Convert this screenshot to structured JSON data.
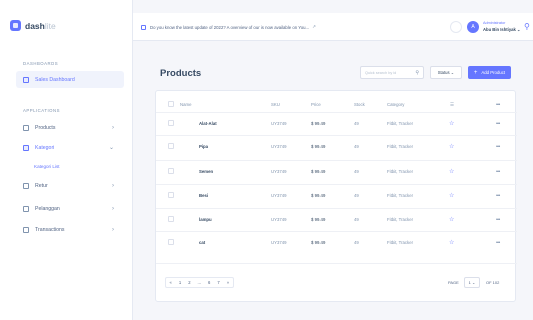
{
  "brand": {
    "name": "dash",
    "suffix": "lite"
  },
  "sidebar": {
    "sections": [
      {
        "label": "DASHBOARDS"
      },
      {
        "label": "APPLICATIONS"
      }
    ],
    "items": [
      {
        "label": "Sales Dashboard"
      },
      {
        "label": "Products",
        "chevron": "›"
      },
      {
        "label": "Kategori",
        "chevron": "⌄"
      },
      {
        "label": "Retur",
        "chevron": "›"
      },
      {
        "label": "Pelanggan",
        "chevron": "›"
      },
      {
        "label": "Transactions",
        "chevron": "›"
      }
    ],
    "sub_item": "Kategori List"
  },
  "topbar": {
    "notice": "Do you know the latest update of 2022? A overview of our is now available on You...",
    "notice_icon": "external-link-icon",
    "ext": "↗",
    "avatar_initial": "A",
    "user_role": "Administrator",
    "user_name": "Abu Bin Ishtiyak",
    "user_caret": "⌄",
    "bell": "🔔"
  },
  "main": {
    "title": "Products",
    "search_placeholder": "Quick search by id",
    "search_icon": "⚲",
    "status_label": "Status ⌄",
    "add_label": "Add Product",
    "add_icon": "+"
  },
  "table": {
    "headers": {
      "name": "Name",
      "sku": "SKU",
      "price": "Price",
      "stock": "Stock",
      "category": "Category",
      "star": "☰",
      "more": "•••"
    },
    "rows": [
      {
        "name": "Alat-Alat",
        "sku": "UY3749",
        "price": "$ 99.49",
        "stock": "49",
        "category": "Fitbit, Tracker",
        "star": "☆",
        "more": "•••"
      },
      {
        "name": "Pipa",
        "sku": "UY3749",
        "price": "$ 99.49",
        "stock": "49",
        "category": "Fitbit, Tracker",
        "star": "☆",
        "more": "•••"
      },
      {
        "name": "Semen",
        "sku": "UY3749",
        "price": "$ 99.49",
        "stock": "49",
        "category": "Fitbit, Tracker",
        "star": "☆",
        "more": "•••"
      },
      {
        "name": "Besi",
        "sku": "UY3749",
        "price": "$ 99.49",
        "stock": "49",
        "category": "Fitbit, Tracker",
        "star": "☆",
        "more": "•••"
      },
      {
        "name": "lampu",
        "sku": "UY3749",
        "price": "$ 99.49",
        "stock": "49",
        "category": "Fitbit, Tracker",
        "star": "☆",
        "more": "•••"
      },
      {
        "name": "cat",
        "sku": "UY3749",
        "price": "$ 99.49",
        "stock": "49",
        "category": "Fitbit, Tracker",
        "star": "☆",
        "more": "•••"
      }
    ]
  },
  "pagination": {
    "prev": "«",
    "pages": [
      "1",
      "2",
      "...",
      "6",
      "7"
    ],
    "next": "»",
    "page_label": "PAGE",
    "current_page": "1 ⌄",
    "of_label": "OF 102"
  },
  "colors": {
    "accent": "#6576ff",
    "text": "#364a63",
    "muted": "#8094ae",
    "background": "#f5f6fa"
  }
}
